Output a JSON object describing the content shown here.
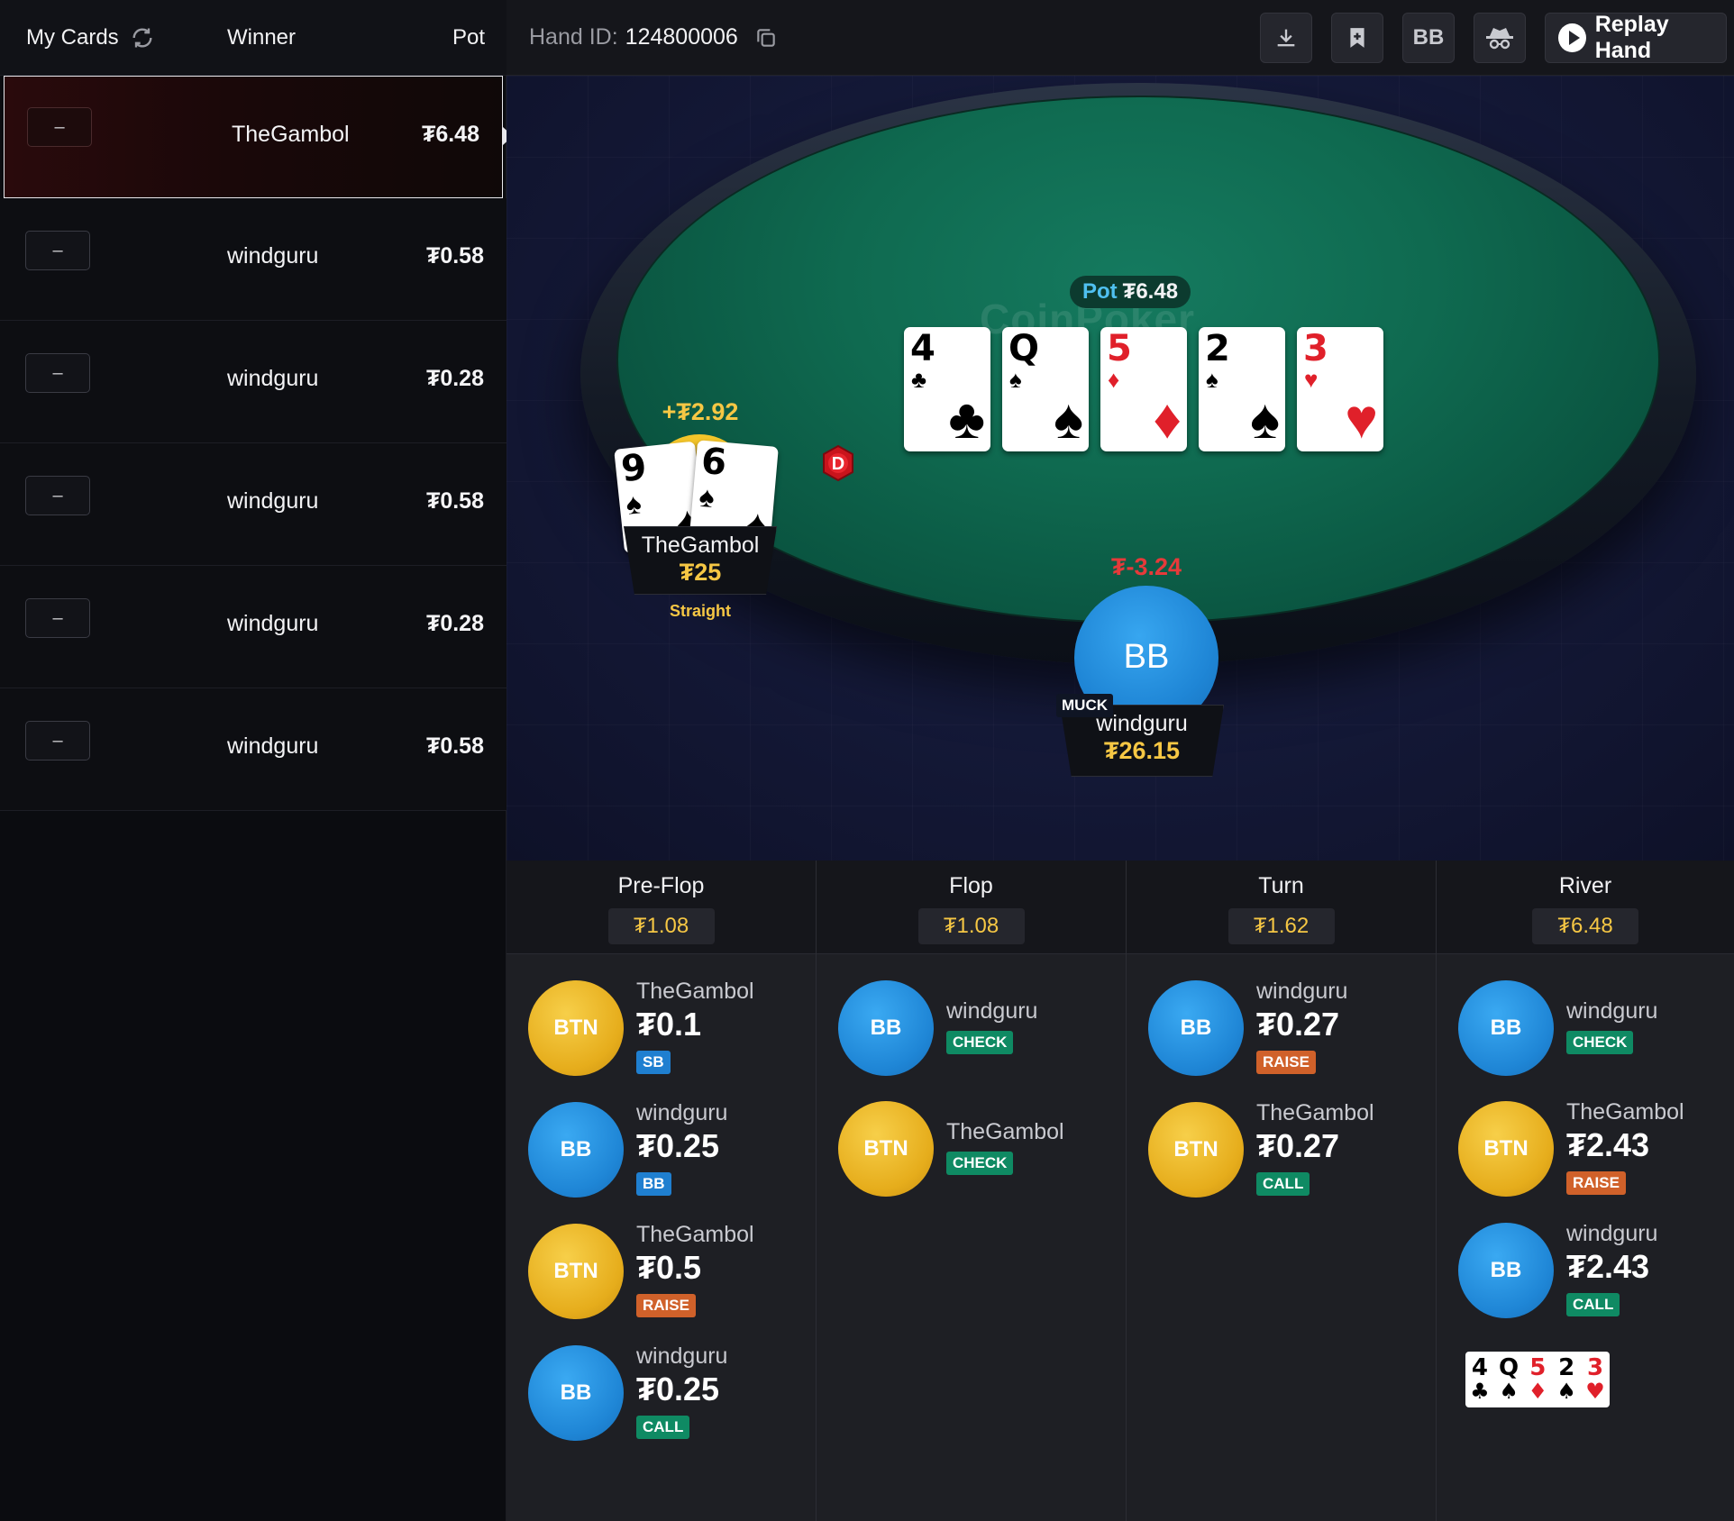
{
  "left_panel": {
    "header": {
      "my_cards": "My Cards",
      "winner": "Winner",
      "pot": "Pot"
    },
    "hands": [
      {
        "cards": "–",
        "winner": "TheGambol",
        "pot": "₮6.48",
        "selected": true
      },
      {
        "cards": "–",
        "winner": "windguru",
        "pot": "₮0.58"
      },
      {
        "cards": "–",
        "winner": "windguru",
        "pot": "₮0.28"
      },
      {
        "cards": "–",
        "winner": "windguru",
        "pot": "₮0.58"
      },
      {
        "cards": "–",
        "winner": "windguru",
        "pot": "₮0.28"
      },
      {
        "cards": "–",
        "winner": "windguru",
        "pot": "₮0.58"
      }
    ]
  },
  "top_bar": {
    "hand_id_label": "Hand ID:",
    "hand_id": "124800006",
    "tools": [
      {
        "name": "download-icon"
      },
      {
        "name": "bookmark-add-icon"
      },
      {
        "name": "bb-toggle",
        "label": "BB"
      },
      {
        "name": "incognito-icon"
      }
    ],
    "replay_label": "Replay Hand"
  },
  "table": {
    "logo_text": "CoinPoker",
    "pot_label": "Pot",
    "pot_value": "₮6.48",
    "board": [
      {
        "rank": "4",
        "suit": "♣",
        "color": "black"
      },
      {
        "rank": "Q",
        "suit": "♠",
        "color": "black"
      },
      {
        "rank": "5",
        "suit": "♦",
        "color": "red"
      },
      {
        "rank": "2",
        "suit": "♠",
        "color": "black"
      },
      {
        "rank": "3",
        "suit": "♥",
        "color": "red"
      }
    ],
    "dealer_label": "D",
    "seats": {
      "gambol": {
        "result": "+₮2.92",
        "name": "TheGambol",
        "stack": "₮25",
        "hand_desc": "Straight",
        "cards": [
          {
            "rank": "9",
            "suit": "♠"
          },
          {
            "rank": "6",
            "suit": "♠"
          }
        ]
      },
      "windguru": {
        "result": "₮-3.24",
        "position": "BB",
        "status": "MUCK",
        "name": "windguru",
        "stack": "₮26.15"
      }
    }
  },
  "streets": [
    {
      "name": "Pre-Flop",
      "pot": "₮1.08",
      "actions": [
        {
          "pos": "BTN",
          "player": "TheGambol",
          "amount": "₮0.1",
          "tag": "SB"
        },
        {
          "pos": "BB",
          "player": "windguru",
          "amount": "₮0.25",
          "tag": "BB"
        },
        {
          "pos": "BTN",
          "player": "TheGambol",
          "amount": "₮0.5",
          "tag": "RAISE"
        },
        {
          "pos": "BB",
          "player": "windguru",
          "amount": "₮0.25",
          "tag": "CALL"
        }
      ]
    },
    {
      "name": "Flop",
      "pot": "₮1.08",
      "actions": [
        {
          "pos": "BB",
          "player": "windguru",
          "tag": "CHECK"
        },
        {
          "pos": "BTN",
          "player": "TheGambol",
          "tag": "CHECK"
        }
      ]
    },
    {
      "name": "Turn",
      "pot": "₮1.62",
      "actions": [
        {
          "pos": "BB",
          "player": "windguru",
          "amount": "₮0.27",
          "tag": "RAISE"
        },
        {
          "pos": "BTN",
          "player": "TheGambol",
          "amount": "₮0.27",
          "tag": "CALL"
        }
      ]
    },
    {
      "name": "River",
      "pot": "₮6.48",
      "actions": [
        {
          "pos": "BB",
          "player": "windguru",
          "tag": "CHECK"
        },
        {
          "pos": "BTN",
          "player": "TheGambol",
          "amount": "₮2.43",
          "tag": "RAISE"
        },
        {
          "pos": "BB",
          "player": "windguru",
          "amount": "₮2.43",
          "tag": "CALL"
        }
      ]
    }
  ],
  "board_mini": [
    {
      "rank": "4",
      "suit": "♣",
      "color": "black"
    },
    {
      "rank": "Q",
      "suit": "♠",
      "color": "black"
    },
    {
      "rank": "5",
      "suit": "♦",
      "color": "red"
    },
    {
      "rank": "2",
      "suit": "♠",
      "color": "black"
    },
    {
      "rank": "3",
      "suit": "♥",
      "color": "red"
    }
  ],
  "colors": {
    "gold": "#f6c744",
    "red_card": "#e0202a",
    "blue_chip": "#1f86d6",
    "felt": "#0f6a50"
  }
}
